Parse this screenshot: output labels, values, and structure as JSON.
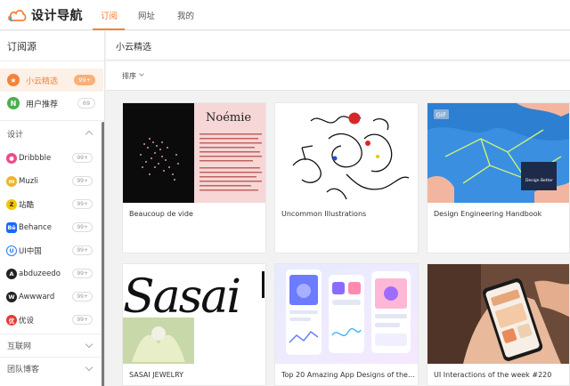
{
  "app": {
    "name": "设计导航"
  },
  "nav": {
    "tabs": [
      {
        "label": "订阅",
        "active": true
      },
      {
        "label": "网址",
        "active": false
      },
      {
        "label": "我的",
        "active": false
      }
    ]
  },
  "sidebar": {
    "title": "订阅源",
    "feeds": [
      {
        "label": "小云精选",
        "count": "99+",
        "icon": "star-icon",
        "color": "#f5813a",
        "active": true
      },
      {
        "label": "用户推荐",
        "count": "69",
        "icon": "n-icon",
        "color": "#4caf50",
        "active": false
      }
    ],
    "groups": [
      {
        "label": "设计",
        "expanded": true
      },
      {
        "label": "互联网",
        "expanded": false
      },
      {
        "label": "团队博客",
        "expanded": false
      }
    ],
    "sources": [
      {
        "label": "Dribbble",
        "count": "99+",
        "icon": "dribbble-icon",
        "color": "#ea4c89"
      },
      {
        "label": "Muzli",
        "count": "99+",
        "icon": "muzli-icon",
        "color": "#f0b429"
      },
      {
        "label": "站酷",
        "count": "99+",
        "icon": "zcool-icon",
        "color": "#f5c400"
      },
      {
        "label": "Behance",
        "count": "99+",
        "icon": "behance-icon",
        "color": "#1769ff"
      },
      {
        "label": "UI中国",
        "count": "99+",
        "icon": "uichina-icon",
        "color": "#2b7de9"
      },
      {
        "label": "abduzeedo",
        "count": "99+",
        "icon": "abduzeedo-icon",
        "color": "#222222"
      },
      {
        "label": "Awwward",
        "count": "99+",
        "icon": "awwwards-icon",
        "color": "#222222"
      },
      {
        "label": "优设",
        "count": "99+",
        "icon": "uisdc-icon",
        "color": "#e53935"
      }
    ]
  },
  "main": {
    "title": "小云精选",
    "sort_label": "排序",
    "cards": [
      {
        "title": "Beaucoup de vide",
        "art_heading": "Noémie"
      },
      {
        "title": "Uncommon Illustrations"
      },
      {
        "title": "Design Engineering Handbook",
        "tag": "GIF",
        "art_label": "Design Better"
      },
      {
        "title": "SASAI JEWELRY",
        "art_heading": "Sasai"
      },
      {
        "title": "Top 20 Amazing App Designs of the We..."
      },
      {
        "title": "UI Interactions of the week #220"
      }
    ]
  },
  "colors": {
    "accent": "#f5813a"
  }
}
